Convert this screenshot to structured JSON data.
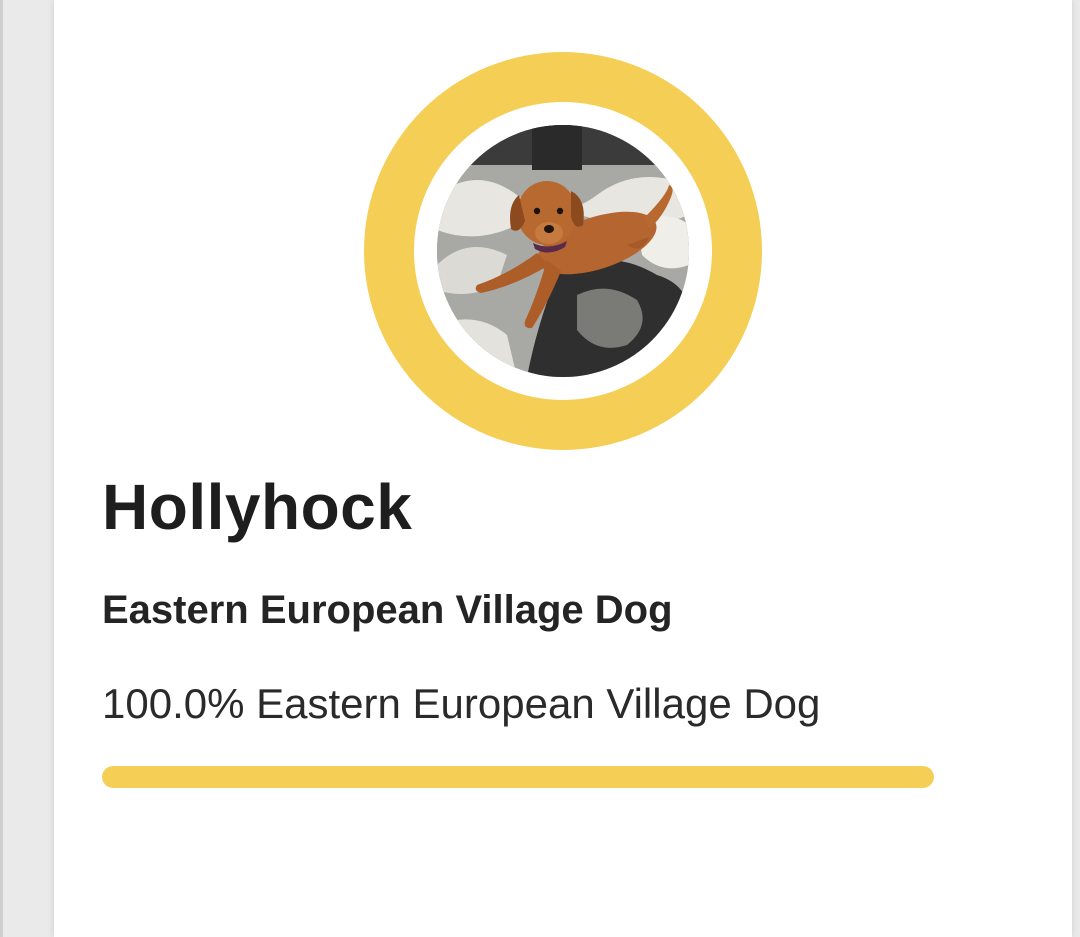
{
  "profile": {
    "name": "Hollyhock",
    "breed": "Eastern European Village Dog",
    "photo_icon": "dog-photo"
  },
  "ancestry": {
    "label": "100.0% Eastern European Village Dog",
    "percent": 100.0
  },
  "colors": {
    "accent": "#f5ce55"
  }
}
